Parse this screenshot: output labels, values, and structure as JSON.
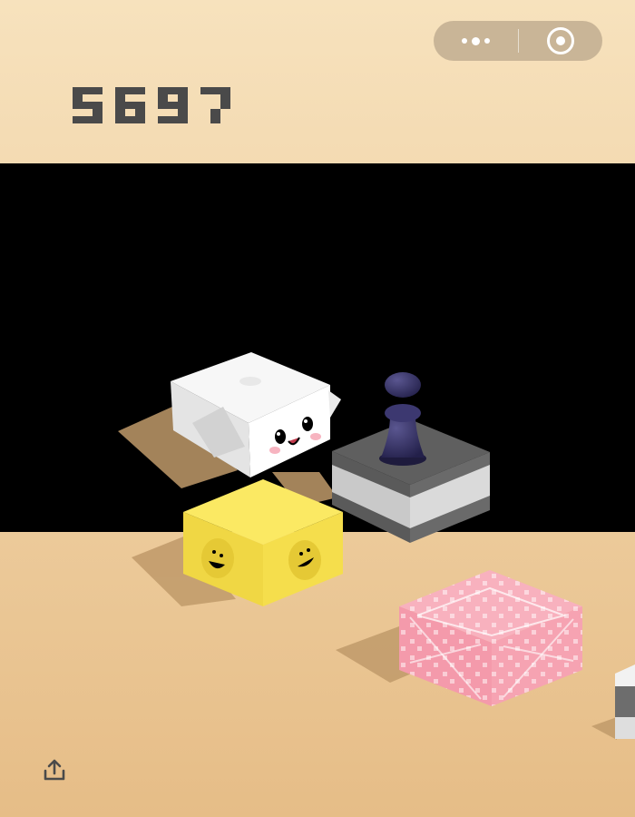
{
  "score": {
    "value": "5697",
    "color": "#4a4a4a"
  },
  "capsule": {
    "more": {
      "icon": "more-dots-icon"
    },
    "close": {
      "icon": "close-target-icon"
    }
  },
  "share": {
    "icon": "share-upload-icon"
  },
  "colors": {
    "background_top": "#f7e2bd",
    "background_bottom": "#e6bd87",
    "void": "#000000",
    "shadow": "#b8976a",
    "white_block": "#f6f6f6",
    "yellow_block": "#fae65a",
    "pink_block": "#f8a9b7",
    "grey_block": "#6a6a6a",
    "player_piece": "#2f2b5a"
  },
  "blocks": [
    {
      "type": "white-cube-face",
      "face": "kawaii"
    },
    {
      "type": "grey-striped-platform"
    },
    {
      "type": "yellow-smiley-cube"
    },
    {
      "type": "pink-gift-cube"
    },
    {
      "type": "grey-cube-edge"
    }
  ],
  "player": {
    "type": "chess-piece"
  }
}
